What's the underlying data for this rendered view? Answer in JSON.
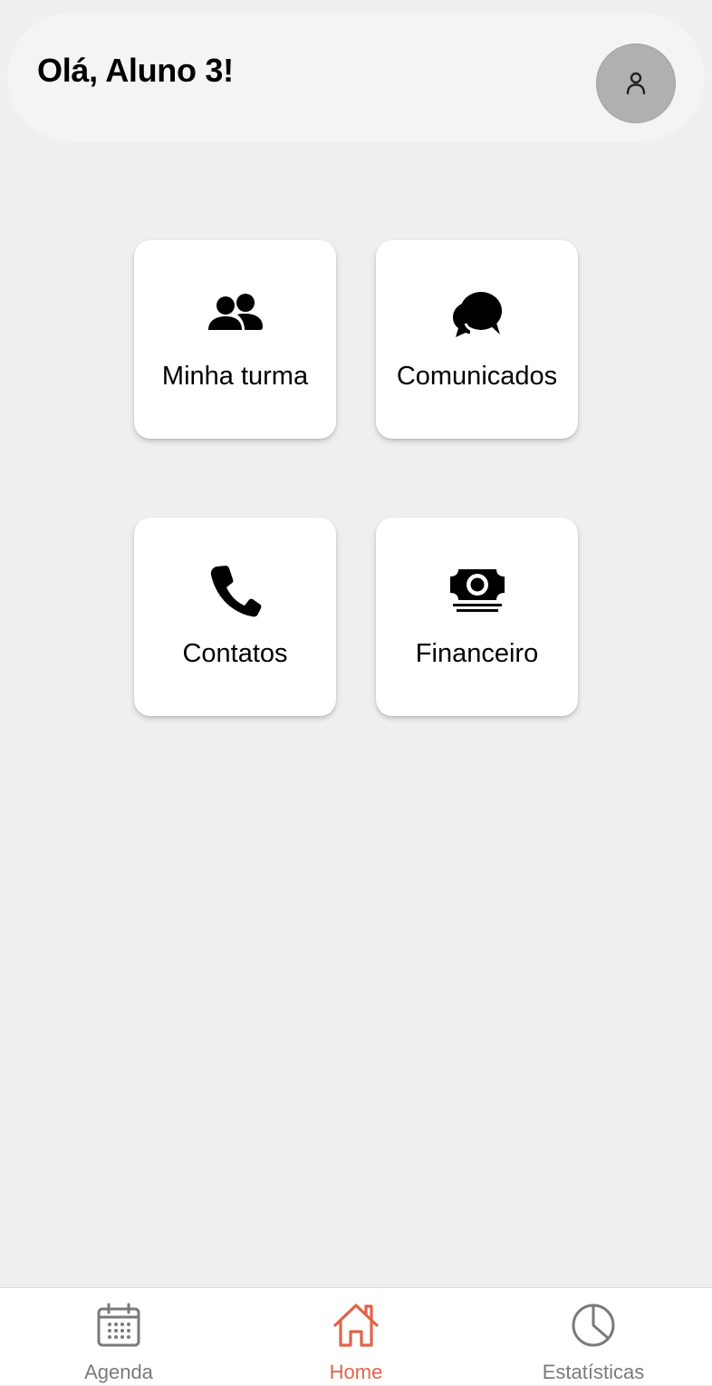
{
  "header": {
    "greeting": "Olá, Aluno 3!",
    "avatar_icon": "user-icon"
  },
  "menu": [
    {
      "label": "Minha turma",
      "icon": "users-icon"
    },
    {
      "label": "Comunicados",
      "icon": "comments-icon"
    },
    {
      "label": "Contatos",
      "icon": "phone-icon"
    },
    {
      "label": "Financeiro",
      "icon": "money-bill-icon"
    }
  ],
  "bottom_nav": {
    "items": [
      {
        "label": "Agenda",
        "icon": "calendar-icon",
        "active": false
      },
      {
        "label": "Home",
        "icon": "home-icon",
        "active": true
      },
      {
        "label": "Estatísticas",
        "icon": "pie-chart-icon",
        "active": false
      }
    ]
  },
  "colors": {
    "background": "#efefef",
    "accent": "#e0634a",
    "inactive_nav": "#7a7a7a",
    "avatar": "#b0b0b0"
  }
}
